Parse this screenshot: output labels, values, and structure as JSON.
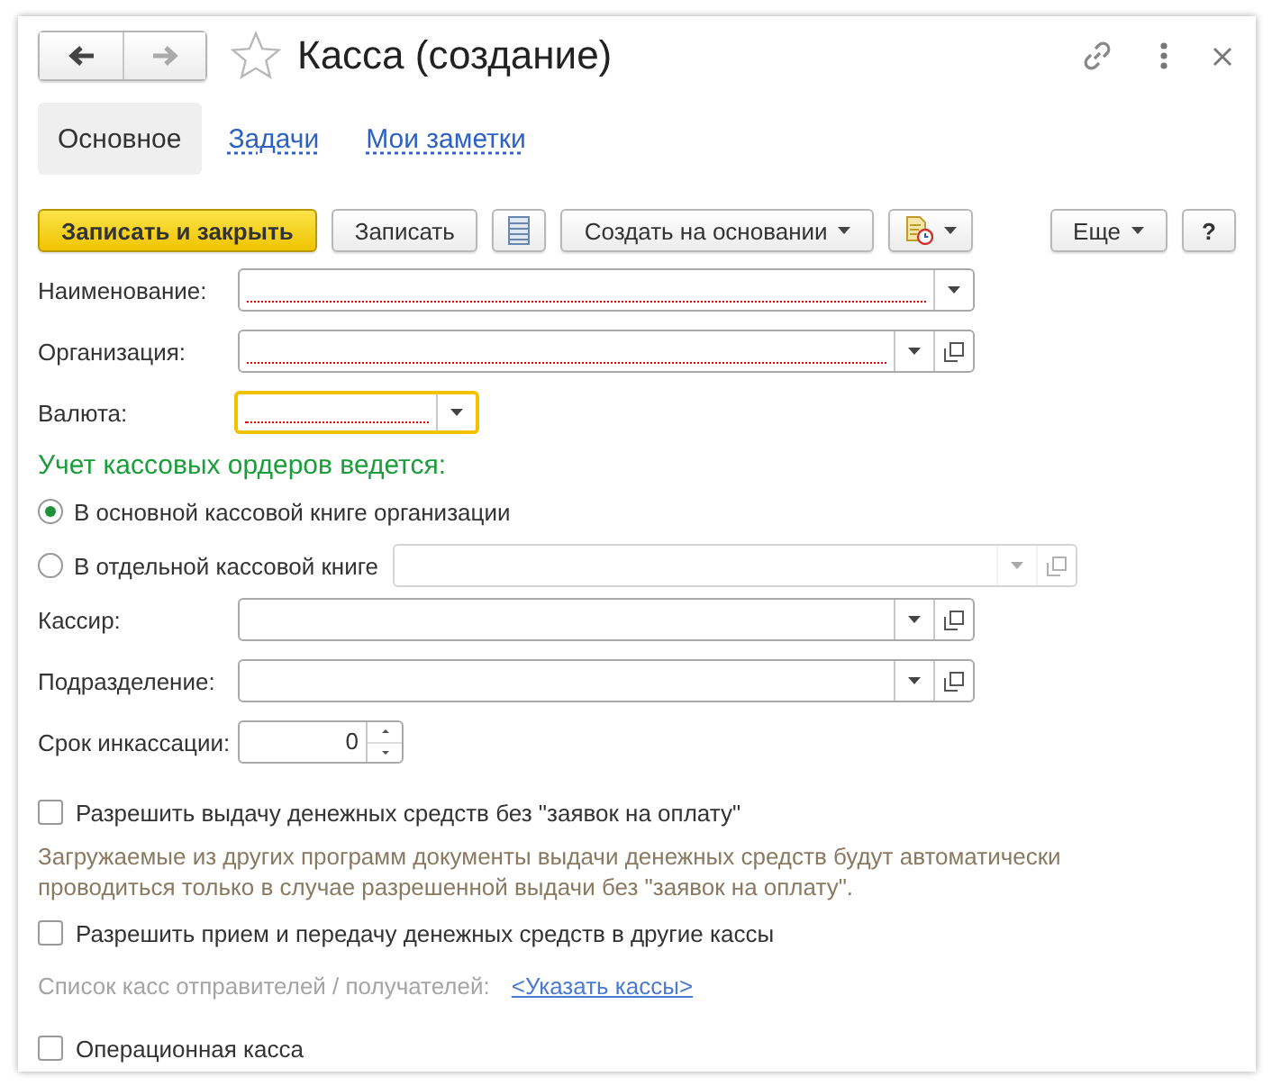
{
  "window": {
    "title": "Касса (создание)",
    "favorite": false
  },
  "nav": [
    {
      "kind": "back",
      "disabled": false
    },
    {
      "kind": "forward",
      "disabled": true
    }
  ],
  "header_icons": [
    {
      "kind": "link"
    },
    {
      "kind": "more"
    },
    {
      "kind": "close"
    }
  ],
  "tabs": [
    {
      "label": "Основное",
      "selected": true
    },
    {
      "label": "Задачи",
      "selected": false
    },
    {
      "label": "Мои заметки",
      "selected": false
    }
  ],
  "toolbar": [
    {
      "kind": "primary",
      "label": "Записать и закрыть"
    },
    {
      "kind": "text",
      "label": "Записать"
    },
    {
      "kind": "icon-list"
    },
    {
      "kind": "menu",
      "label": "Создать на основании"
    },
    {
      "kind": "icon-menu"
    }
  ],
  "toolbar_right": [
    {
      "kind": "menu",
      "label": "Еще"
    },
    {
      "kind": "text",
      "label": "?"
    }
  ],
  "fields": [
    {
      "label": "Наименование:",
      "kind": "select",
      "required": true,
      "focused": false
    },
    {
      "label": "Организация:",
      "kind": "select-open",
      "required": true,
      "focused": false
    },
    {
      "label": "Валюта:",
      "kind": "select-short",
      "required": true,
      "focused": true
    }
  ],
  "section_heading": "Учет кассовых ордеров ведется:",
  "radios": [
    {
      "label": "В основной кассовой книге организации",
      "selected": true,
      "has_field": false
    },
    {
      "label": "В отдельной кассовой книге",
      "selected": false,
      "has_field": true
    }
  ],
  "fields2": [
    {
      "label": "Кассир:",
      "kind": "select-open",
      "required": false,
      "focused": false
    },
    {
      "label": "Подразделение:",
      "kind": "select-open",
      "required": false,
      "focused": false
    }
  ],
  "number_field": {
    "label": "Срок инкассации:",
    "value": "0"
  },
  "options": [
    {
      "kind": "checkbox",
      "label": "Разрешить выдачу денежных средств без \"заявок на оплату\"",
      "checked": false
    },
    {
      "kind": "note",
      "label": "Загружаемые из других программ документы выдачи денежных средств будут автоматически проводиться только в случае разрешенной выдачи без \"заявок на оплату\"."
    },
    {
      "kind": "checkbox",
      "label": "Разрешить прием и передачу денежных средств в другие кассы",
      "checked": false
    },
    {
      "kind": "link-row",
      "label": "Список касс отправителей / получателей:",
      "link": "<Указать кассы>"
    },
    {
      "kind": "checkbox",
      "label": "Операционная касса",
      "checked": false
    }
  ]
}
